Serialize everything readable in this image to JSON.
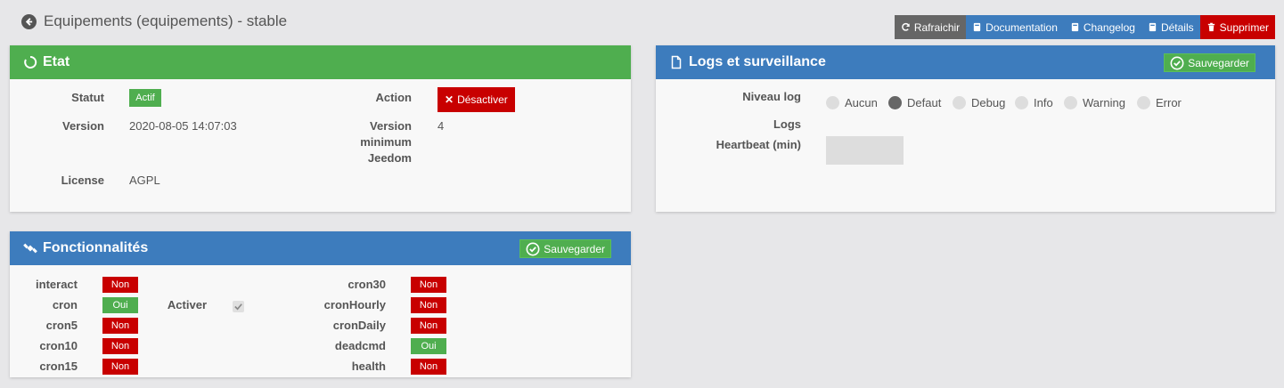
{
  "header": {
    "title": "Equipements (equipements) - stable"
  },
  "toolbar": {
    "refresh": "Rafraichir",
    "documentation": "Documentation",
    "changelog": "Changelog",
    "details": "Détails",
    "delete": "Supprimer"
  },
  "etat": {
    "title": "Etat",
    "statut_label": "Statut",
    "statut_value": "Actif",
    "action_label": "Action",
    "action_button": "Désactiver",
    "version_label": "Version",
    "version_value": "2020-08-05 14:07:03",
    "min_version_label_1": "Version",
    "min_version_label_2": "minimum",
    "min_version_label_3": "Jeedom",
    "min_version_value": "4",
    "license_label": "License",
    "license_value": "AGPL"
  },
  "logs": {
    "title": "Logs et surveillance",
    "save": "Sauvegarder",
    "niveau_label": "Niveau log",
    "levels": [
      "Aucun",
      "Defaut",
      "Debug",
      "Info",
      "Warning",
      "Error"
    ],
    "selected_level": "Defaut",
    "logs_label": "Logs",
    "heartbeat_label": "Heartbeat (min)",
    "heartbeat_value": ""
  },
  "features": {
    "title": "Fonctionnalités",
    "save": "Sauvegarder",
    "activer_label": "Activer",
    "activer_checked": true,
    "left": [
      {
        "name": "interact",
        "state": "Non"
      },
      {
        "name": "cron",
        "state": "Oui"
      },
      {
        "name": "cron5",
        "state": "Non"
      },
      {
        "name": "cron10",
        "state": "Non"
      },
      {
        "name": "cron15",
        "state": "Non"
      }
    ],
    "right": [
      {
        "name": "cron30",
        "state": "Non"
      },
      {
        "name": "cronHourly",
        "state": "Non"
      },
      {
        "name": "cronDaily",
        "state": "Non"
      },
      {
        "name": "deadcmd",
        "state": "Oui"
      },
      {
        "name": "health",
        "state": "Non"
      }
    ]
  },
  "colors": {
    "green": "#4fae4f",
    "blue": "#3d7cbd",
    "red": "#c80000",
    "grey": "#666666"
  }
}
